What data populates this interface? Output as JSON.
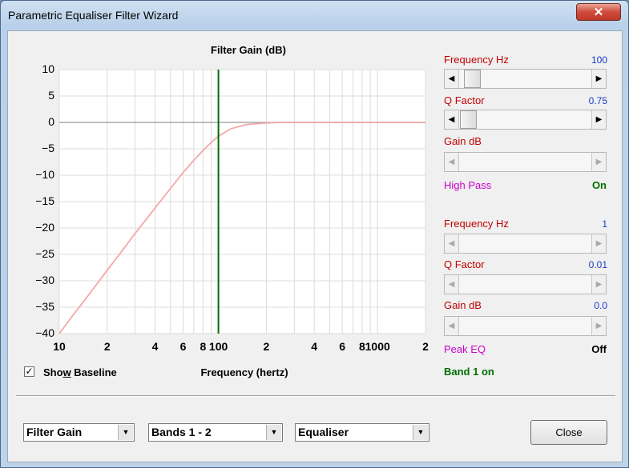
{
  "window": {
    "title": "Parametric Equaliser Filter Wizard",
    "close_glyph": "✕"
  },
  "chart": {
    "title": "Filter Gain (dB)",
    "xlabel": "Frequency (hertz)"
  },
  "chart_data": {
    "type": "line",
    "title": "Filter Gain (dB)",
    "xlabel": "Frequency (hertz)",
    "ylabel": "",
    "xscale": "log",
    "xlim": [
      10,
      2000
    ],
    "ylim": [
      -40,
      10
    ],
    "y_ticks": [
      "10",
      "5",
      "0",
      "-5",
      "-10",
      "-15",
      "-20",
      "-25",
      "-30",
      "-35",
      "-40"
    ],
    "x_ticks": [
      "10",
      "2",
      "4",
      "6",
      "8",
      "100",
      "2",
      "4",
      "6",
      "8",
      "1000",
      "2"
    ],
    "grid": true,
    "series": [
      {
        "color": "#f2a8a8",
        "x": [
          10,
          12,
          15,
          20,
          25,
          30,
          40,
          50,
          60,
          70,
          80,
          90,
          100,
          120,
          150,
          200,
          250,
          300,
          500,
          1000,
          2000
        ],
        "y": [
          -40,
          -36.8,
          -33.0,
          -28.0,
          -24.2,
          -21.0,
          -16.2,
          -12.5,
          -9.5,
          -7.2,
          -5.3,
          -3.8,
          -2.6,
          -1.2,
          -0.4,
          -0.1,
          0,
          0,
          0,
          0,
          0
        ]
      }
    ],
    "baseline": {
      "y": 0,
      "color": "#a8a8a8"
    },
    "marker": {
      "x": 100,
      "color": "#007000"
    }
  },
  "checkbox": {
    "label_pre": "Sho",
    "label_u": "w",
    "label_post": " Baseline",
    "checked": true,
    "check_glyph": "✓"
  },
  "band1": {
    "freq_label": "Frequency  Hz",
    "freq_value": "100",
    "q_label": "Q Factor",
    "q_value": "0.75",
    "gain_label": "Gain  dB",
    "gain_value": "",
    "type_label": "High Pass",
    "type_state": "On"
  },
  "band2": {
    "freq_label": "Frequency  Hz",
    "freq_value": "1",
    "q_label": "Q Factor",
    "q_value": "0.01",
    "gain_label": "Gain  dB",
    "gain_value": "0.0",
    "type_label": "Peak EQ",
    "type_state": "Off"
  },
  "status": "Band 1 on",
  "scroll_glyphs": {
    "left": "◀",
    "right": "▶"
  },
  "combos": {
    "view": "Filter Gain",
    "bands": "Bands 1 - 2",
    "mode": "Equaliser",
    "arrow": "▼"
  },
  "close_label": "Close",
  "colors": {
    "label_red": "#c00000",
    "value_blue": "#1a3cc8",
    "magenta": "#cc00cc",
    "green": "#007000"
  }
}
